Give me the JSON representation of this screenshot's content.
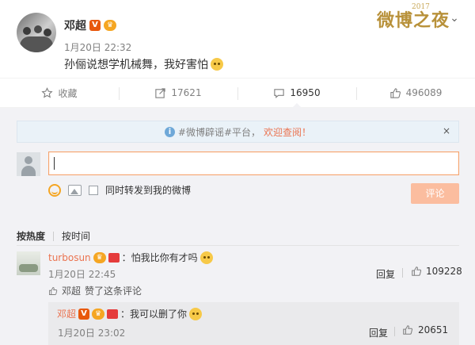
{
  "post": {
    "author": "邓超",
    "time": "1月20日 22:32",
    "text": "孙俪说想学机械舞，我好害怕",
    "emoji_icon": "cat-laugh-emoji"
  },
  "header": {
    "festival_logo": "微博之夜",
    "festival_year": "2017",
    "menu_icon": "chevron-down-icon"
  },
  "actions": {
    "favorite_label": "收藏",
    "repost_count": "17621",
    "comment_count": "16950",
    "like_count": "496089"
  },
  "notice": {
    "tag": "#微博辟谣#平台，",
    "link": "欢迎查阅！",
    "close": "×"
  },
  "composer": {
    "input_value": "",
    "sync_label": "同时转发到我的微博",
    "submit_label": "评论"
  },
  "sort": {
    "by_hot": "按热度",
    "by_time": "按时间"
  },
  "comment": {
    "user": "turbosun",
    "text": "：怕我比你有才吗",
    "time": "1月20日 22:45",
    "reply_label": "回复",
    "like_count": "109228",
    "liked_by_user": "邓超",
    "liked_by_suffix": "赞了这条评论"
  },
  "sub_reply": {
    "user": "邓超",
    "text": "：我可以删了你",
    "time": "1月20日 23:02",
    "reply_label": "回复",
    "like_count": "20651"
  },
  "colors": {
    "accent": "#eb7350",
    "submit_disabled": "#fbbd9f",
    "background": "#f2f2f5"
  }
}
